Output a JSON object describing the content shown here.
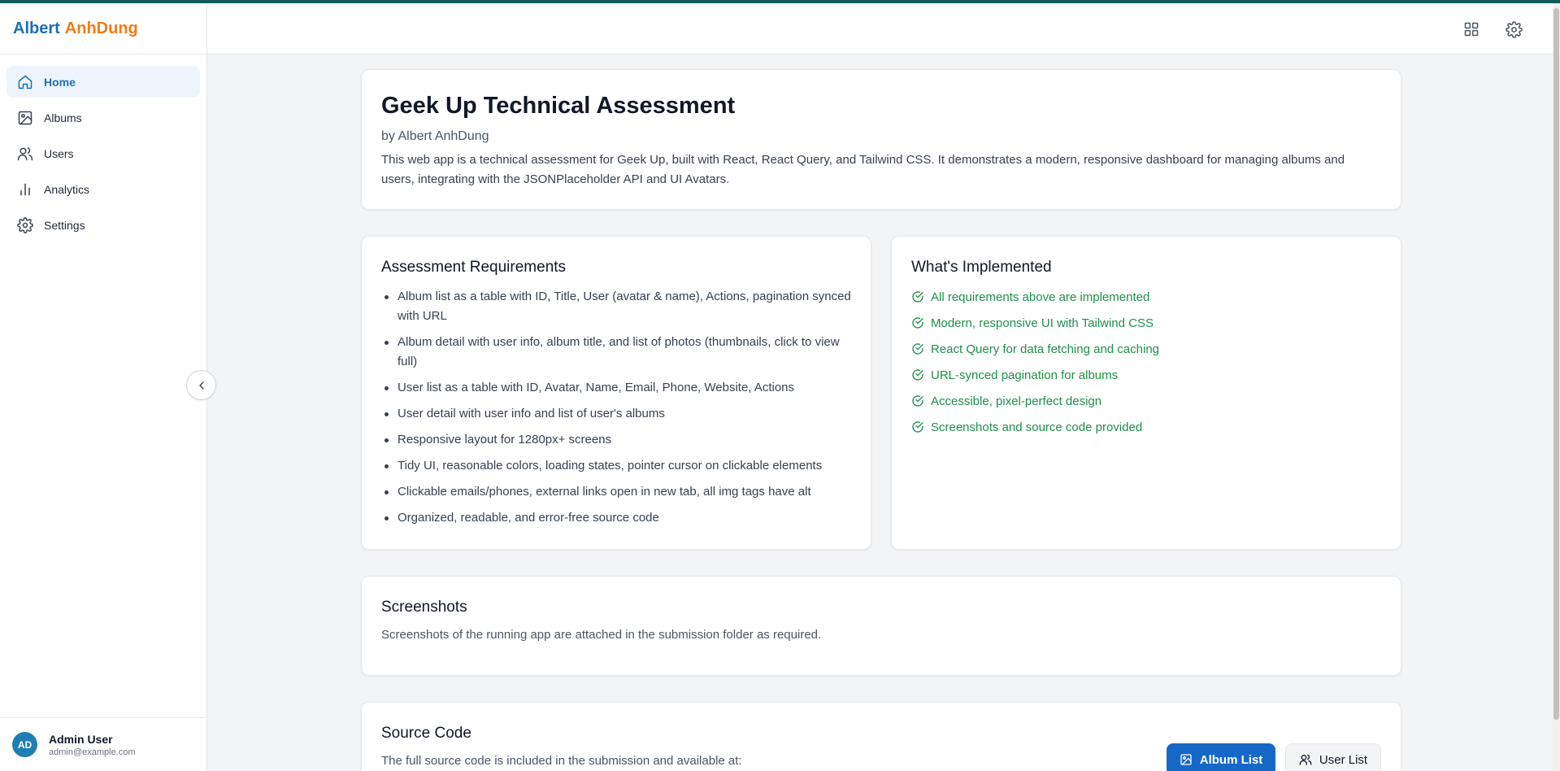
{
  "brand": {
    "first": "Albert",
    "second": "AnhDung"
  },
  "sidebar": {
    "items": [
      {
        "label": "Home",
        "icon": "home-icon",
        "active": true
      },
      {
        "label": "Albums",
        "icon": "image-icon"
      },
      {
        "label": "Users",
        "icon": "users-icon"
      },
      {
        "label": "Analytics",
        "icon": "bar-chart-icon"
      },
      {
        "label": "Settings",
        "icon": "gear-icon"
      }
    ],
    "user": {
      "initials": "AD",
      "name": "Admin User",
      "email": "admin@example.com"
    }
  },
  "header": {
    "icons": [
      "grid-icon",
      "gear-icon"
    ]
  },
  "intro": {
    "title": "Geek Up Technical Assessment",
    "byline": "by Albert AnhDung",
    "description": "This web app is a technical assessment for Geek Up, built with React, React Query, and Tailwind CSS. It demonstrates a modern, responsive dashboard for managing albums and users, integrating with the JSONPlaceholder API and UI Avatars."
  },
  "requirements": {
    "title": "Assessment Requirements",
    "items": [
      "Album list as a table with ID, Title, User (avatar & name), Actions, pagination synced with URL",
      "Album detail with user info, album title, and list of photos (thumbnails, click to view full)",
      "User list as a table with ID, Avatar, Name, Email, Phone, Website, Actions",
      "User detail with user info and list of user's albums",
      "Responsive layout for 1280px+ screens",
      "Tidy UI, reasonable colors, loading states, pointer cursor on clickable elements",
      "Clickable emails/phones, external links open in new tab, all img tags have alt",
      "Organized, readable, and error-free source code"
    ]
  },
  "implemented": {
    "title": "What's Implemented",
    "items": [
      "All requirements above are implemented",
      "Modern, responsive UI with Tailwind CSS",
      "React Query for data fetching and caching",
      "URL-synced pagination for albums",
      "Accessible, pixel-perfect design",
      "Screenshots and source code provided"
    ]
  },
  "screenshots": {
    "title": "Screenshots",
    "text": "Screenshots of the running app are attached in the submission folder as required."
  },
  "source": {
    "title": "Source Code",
    "text": "The full source code is included in the submission and available at:",
    "buttons": {
      "album_list": "Album List",
      "user_list": "User List"
    }
  },
  "colors": {
    "primary": "#1668c7",
    "brand_blue": "#1d6fb5",
    "brand_orange": "#f07b16",
    "success": "#1f8f4a",
    "accent_bar": "#0f5e5a"
  }
}
